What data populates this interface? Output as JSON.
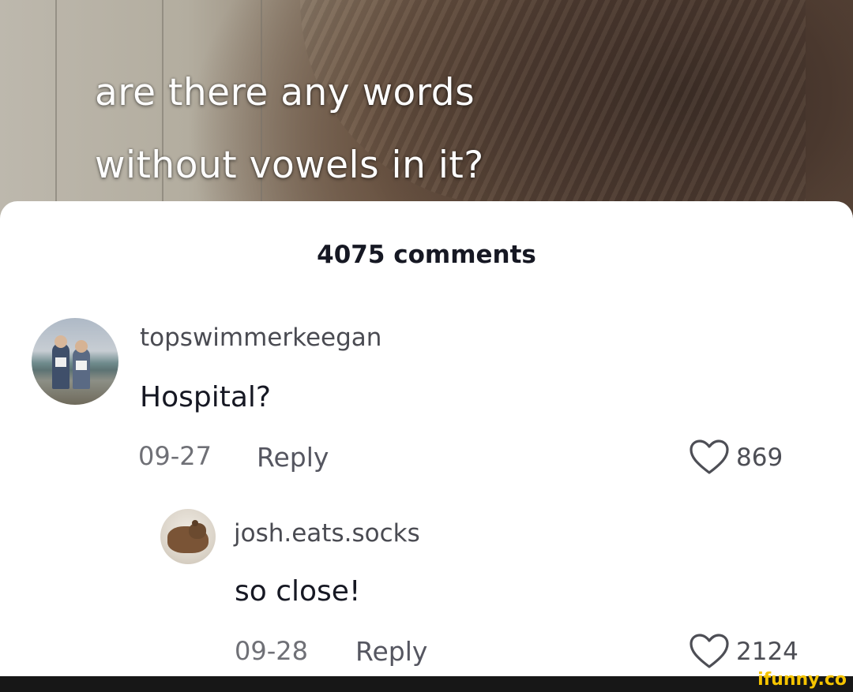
{
  "video": {
    "caption_line1": "are there any words",
    "caption_line2": "without vowels in it?"
  },
  "comments_header": {
    "count_label": "4075 comments"
  },
  "comments": [
    {
      "username": "topswimmerkeegan",
      "text": "Hospital?",
      "date": "09-27",
      "reply_label": "Reply",
      "likes": "869",
      "avatar_icon": "two-people-photo-avatar"
    },
    {
      "username": "josh.eats.socks",
      "text": "so close!",
      "date": "09-28",
      "reply_label": "Reply",
      "likes": "2124",
      "avatar_icon": "capybara-photo-avatar"
    }
  ],
  "watermark": {
    "text": "ifunny.co",
    "color": "#f5c400"
  },
  "colors": {
    "primary_text": "#161823",
    "secondary_text": "#4a4b52",
    "meta_text": "#6f7076",
    "heart_outline": "#4d4e55"
  }
}
